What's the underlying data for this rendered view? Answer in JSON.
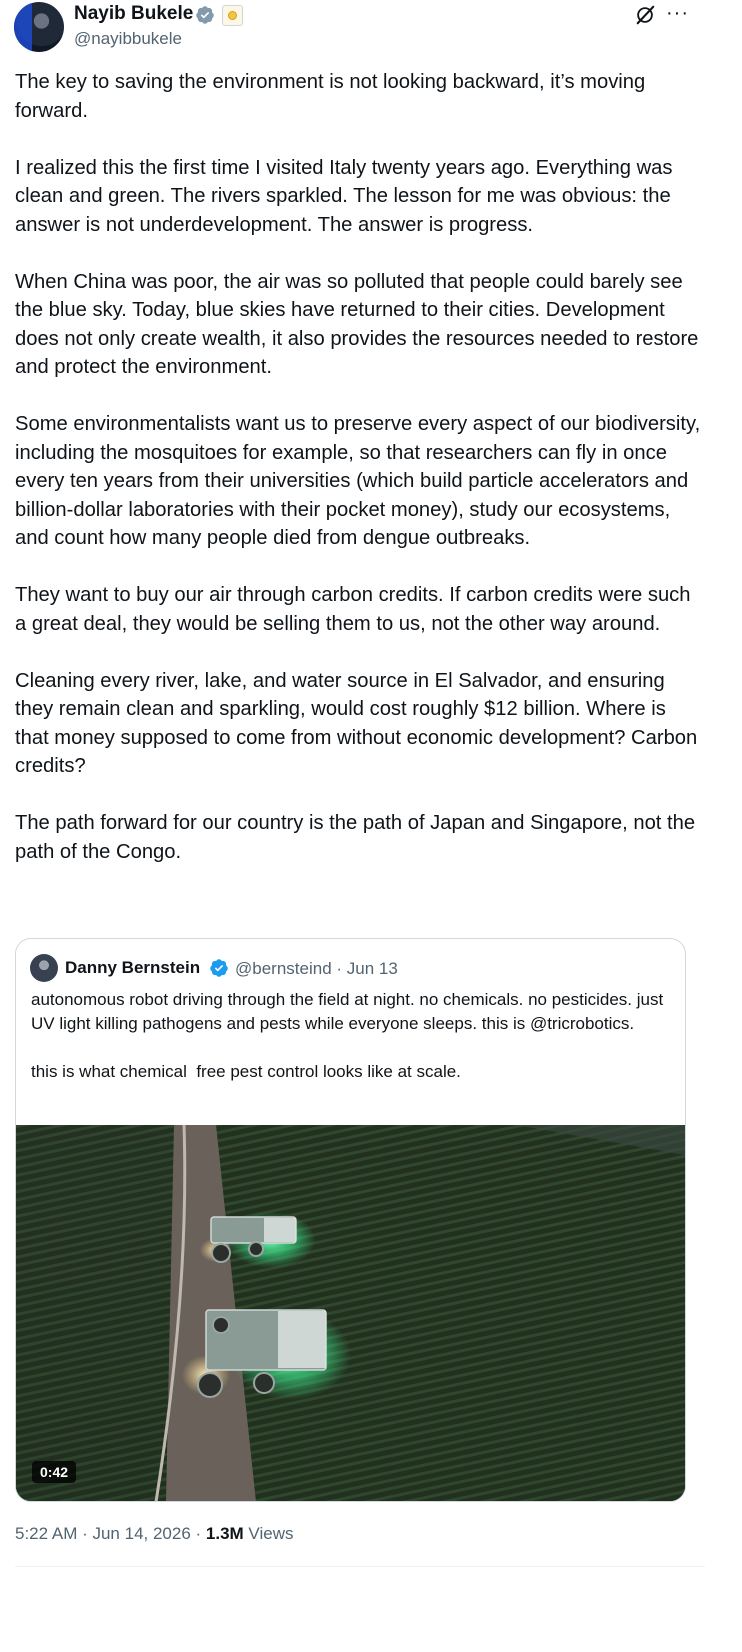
{
  "author": {
    "name": "Nayib Bukele",
    "handle": "@nayibbukele"
  },
  "tweet_text": "The key to saving the environment is not looking backward, it’s moving forward.\n\nI realized this the first time I visited Italy twenty years ago. Everything was clean and green. The rivers sparkled. The lesson for me was obvious: the answer is not underdevelopment. The answer is progress.\n\nWhen China was poor, the air was so polluted that people could barely see the blue sky. Today, blue skies have returned to their cities. Development does not only create wealth, it also provides the resources needed to restore and protect the environment.\n\nSome environmentalists want us to preserve every aspect of our biodiversity, including the mosquitoes for example, so that researchers can fly in once every ten years from their universities (which build particle accelerators and billion-dollar laboratories with their pocket money), study our ecosystems, and count how many people died from dengue outbreaks.\n\nThey want to buy our air through carbon credits. If carbon credits were such a great deal, they would be selling them to us, not the other way around.\n\nCleaning every river, lake, and water source in El Salvador, and ensuring they remain clean and sparkling, would cost roughly $12 billion. Where is that money supposed to come from without economic development? Carbon credits?\n\nThe path forward for our country is the path of Japan and Singapore, not the path of the Congo.",
  "quote": {
    "name": "Danny Bernstein",
    "handle_date": "@bernsteind · Jun 13",
    "text": "autonomous robot driving through the field at night. no chemicals. no pesticides. just UV light killing pathogens and pests while everyone sleeps. this is @tricrobotics.\n\nthis is what chemical  free pest control looks like at scale.",
    "video_duration": "0:42"
  },
  "meta": {
    "time_date": "5:22 AM · Jun 14, 2026 · ",
    "views_count": "1.3M",
    "views_label": " Views"
  },
  "colors": {
    "verified_blue": "#1d9bf0",
    "uv_glow": "#3dff9a",
    "secondary_text": "#536471"
  }
}
